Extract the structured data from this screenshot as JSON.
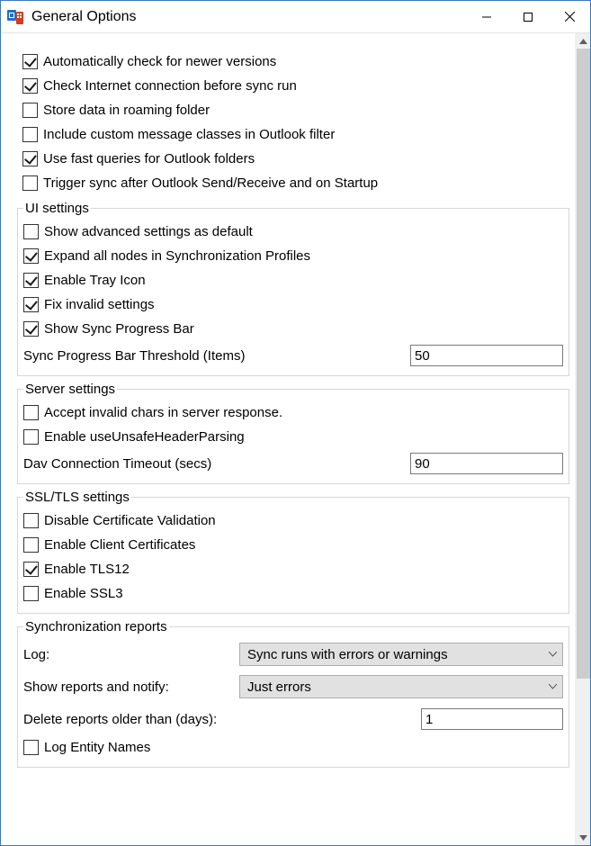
{
  "window": {
    "title": "General Options"
  },
  "general": {
    "auto_check": {
      "label": "Automatically check for newer versions",
      "checked": true
    },
    "check_internet": {
      "label": "Check Internet connection before sync run",
      "checked": true
    },
    "store_roaming": {
      "label": "Store data in roaming folder",
      "checked": false
    },
    "include_custom_classes": {
      "label": "Include custom message classes in Outlook filter",
      "checked": false
    },
    "fast_queries": {
      "label": "Use fast queries for Outlook folders",
      "checked": true
    },
    "trigger_sync": {
      "label": "Trigger sync after Outlook Send/Receive and on Startup",
      "checked": false
    }
  },
  "ui_settings": {
    "legend": "UI settings",
    "show_advanced": {
      "label": "Show advanced settings as default",
      "checked": false
    },
    "expand_nodes": {
      "label": "Expand all nodes in Synchronization Profiles",
      "checked": true
    },
    "tray_icon": {
      "label": "Enable Tray Icon",
      "checked": true
    },
    "fix_invalid": {
      "label": "Fix invalid settings",
      "checked": true
    },
    "show_progress": {
      "label": "Show Sync Progress Bar",
      "checked": true
    },
    "threshold_label": "Sync Progress Bar Threshold (Items)",
    "threshold_value": "50"
  },
  "server_settings": {
    "legend": "Server settings",
    "accept_invalid": {
      "label": "Accept invalid chars in server response.",
      "checked": false
    },
    "unsafe_header": {
      "label": "Enable useUnsafeHeaderParsing",
      "checked": false
    },
    "timeout_label": "Dav Connection Timeout (secs)",
    "timeout_value": "90"
  },
  "ssl_settings": {
    "legend": "SSL/TLS settings",
    "disable_cert": {
      "label": "Disable Certificate Validation",
      "checked": false
    },
    "client_cert": {
      "label": "Enable Client Certificates",
      "checked": false
    },
    "tls12": {
      "label": "Enable TLS12",
      "checked": true
    },
    "ssl3": {
      "label": "Enable SSL3",
      "checked": false
    }
  },
  "sync_reports": {
    "legend": "Synchronization reports",
    "log_label": "Log:",
    "log_value": "Sync runs with errors or warnings",
    "show_label": "Show reports and notify:",
    "show_value": "Just errors",
    "delete_label": "Delete reports older than (days):",
    "delete_value": "1",
    "log_entity": {
      "label": "Log Entity Names",
      "checked": false
    }
  }
}
